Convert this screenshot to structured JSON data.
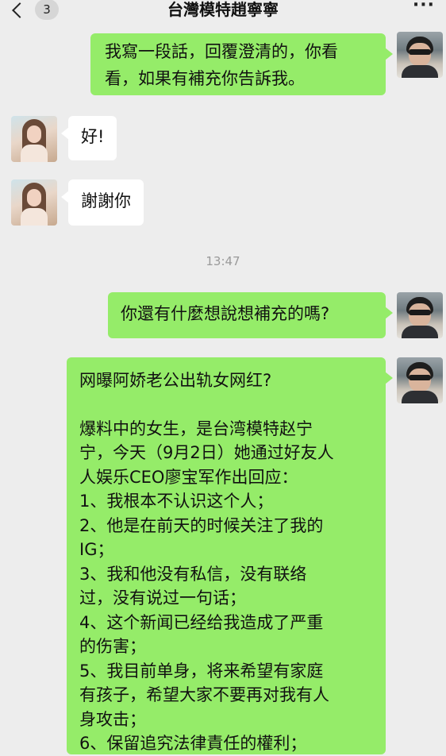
{
  "header": {
    "back_icon": "chevron-left-icon",
    "unread_count": "3",
    "title": "台灣模特趙寧寧",
    "more_label": "···"
  },
  "messages": [
    {
      "sender": "me",
      "text": "我寫一段話，回覆澄清的，你看\n看，如果有補充你告訴我。"
    },
    {
      "sender": "her",
      "text": "好!"
    },
    {
      "sender": "her",
      "text": "謝謝你"
    },
    {
      "sender": "me",
      "text": "你還有什麼想說想補充的嗎?"
    }
  ],
  "timestamp": "13:47",
  "long_message": {
    "sender": "me",
    "lines": [
      "网曝阿娇老公出轨女网红?",
      "",
      "爆料中的女生，是台湾模特赵宁",
      "宁，今天（9月2日）她通过好友人",
      "人娱乐CEO廖宝军作出回应：",
      "1、我根本不认识这个人；",
      "2、他是在前天的时候关注了我的",
      "IG；",
      "3、我和他没有私信，没有联络",
      "过，没有说过一句话；",
      "4、这个新闻已经给我造成了严重",
      "的伤害；",
      "5、我目前单身，将来希望有家庭",
      "有孩子，希望大家不要再对我有人",
      "身攻击；",
      "6、保留追究法律責任的權利；"
    ]
  },
  "colors": {
    "background": "#ededed",
    "my_bubble": "#95ec69",
    "her_bubble": "#ffffff",
    "timestamp": "#9a9a9a"
  }
}
